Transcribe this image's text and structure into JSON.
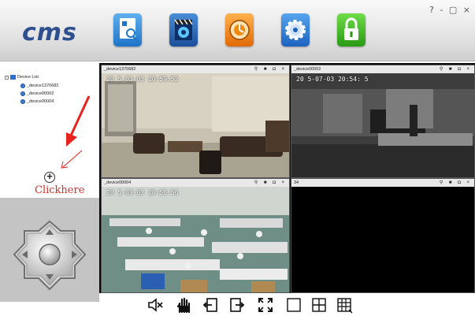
{
  "app": {
    "brand": "cms",
    "window_controls": "? - ▢ ×"
  },
  "toolbar": {
    "icons": [
      "device-manager-icon",
      "recording-icon",
      "remote-playback-icon",
      "settings-icon",
      "lock-icon"
    ]
  },
  "device_tree": {
    "root_label": "Device List",
    "devices": [
      "_device1370682",
      "_device00002",
      "_device00004"
    ]
  },
  "annotation": {
    "add_symbol": "+",
    "hint": "Clickhere",
    "arrow_color": "#e8231d"
  },
  "video_cells": [
    {
      "title": "_device1370682",
      "osd": "20 5-03-03 20:59:52",
      "buttons": "⚲ ■ ◘ ×"
    },
    {
      "title": "_device00002",
      "osd": "20 5-07-03 20:54: 5",
      "buttons": "⚲ ■ ◘ ×"
    },
    {
      "title": "_device00004",
      "osd": "20 5-03-03 20:56:56",
      "buttons": "⚲ ■ ◘ ×"
    },
    {
      "title": "34",
      "osd": "",
      "buttons": "⚲ ■ ◘ ×"
    }
  ],
  "bottom_toolbar": {
    "icons": [
      "mute-icon",
      "hand-icon",
      "previous-page-icon",
      "next-page-icon",
      "fullscreen-icon",
      "single-view-icon",
      "quad-view-icon",
      "multi-view-icon"
    ]
  },
  "colors": {
    "brand": "#2d4f8e",
    "hint_text": "#d6302a",
    "ptz_bg": "#c4c4c4"
  }
}
